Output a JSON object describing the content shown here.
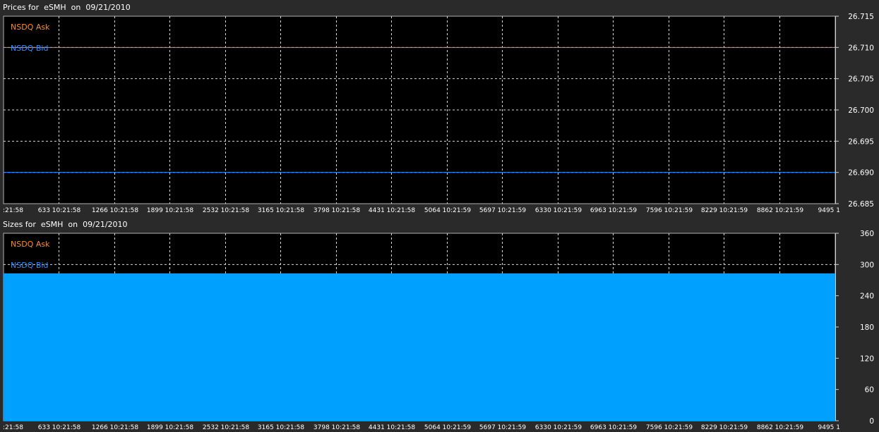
{
  "chart_data": [
    {
      "type": "line",
      "title": "Prices for  eSMH  on  09/21/2010",
      "x_tick_labels": [
        ":21:58",
        "633 10:21:58",
        "1266 10:21:58",
        "1899 10:21:58",
        "2532 10:21:58",
        "3165 10:21:58",
        "3798 10:21:58",
        "4431 10:21:58",
        "5064 10:21:59",
        "5697 10:21:59",
        "6330 10:21:59",
        "6963 10:21:59",
        "7596 10:21:59",
        "8229 10:21:59",
        "8862 10:21:59",
        "9495 1"
      ],
      "y_tick_labels": [
        "26.715",
        "26.710",
        "26.705",
        "26.700",
        "26.695",
        "26.690",
        "26.685"
      ],
      "ylim": [
        26.685,
        26.715
      ],
      "grid": true,
      "legend_position": "top-left",
      "series": [
        {
          "name": "NSDQ Ask",
          "color": "#ff8c1a",
          "line_color": "#e08860",
          "x": [
            0,
            9495
          ],
          "y": [
            26.71,
            26.71
          ]
        },
        {
          "name": "NSDQ Bid",
          "color": "#2b8cff",
          "line_color": "#2b8cff",
          "x": [
            0,
            9495
          ],
          "y": [
            26.69,
            26.69
          ]
        }
      ]
    },
    {
      "type": "area",
      "title": "Sizes for  eSMH  on  09/21/2010",
      "x_tick_labels": [
        ":21:58",
        "633 10:21:58",
        "1266 10:21:58",
        "1899 10:21:58",
        "2532 10:21:58",
        "3165 10:21:58",
        "3798 10:21:58",
        "4431 10:21:58",
        "5064 10:21:59",
        "5697 10:21:59",
        "6330 10:21:59",
        "6963 10:21:59",
        "7596 10:21:59",
        "8229 10:21:59",
        "8862 10:21:59",
        "9495 1"
      ],
      "y_tick_labels": [
        "360",
        "300",
        "240",
        "180",
        "120",
        "60",
        "0"
      ],
      "ylim": [
        0,
        360
      ],
      "grid": true,
      "legend_position": "top-left",
      "series": [
        {
          "name": "NSDQ Ask",
          "color": "#ff8c1a",
          "fill_color": "#f0a030",
          "x": [
            0,
            9495
          ],
          "y": [
            3,
            3
          ]
        },
        {
          "name": "NSDQ Bid",
          "color": "#2b8cff",
          "fill_color": "#00a0ff",
          "x": [
            0,
            9495
          ],
          "y": [
            283,
            283
          ]
        }
      ]
    }
  ]
}
